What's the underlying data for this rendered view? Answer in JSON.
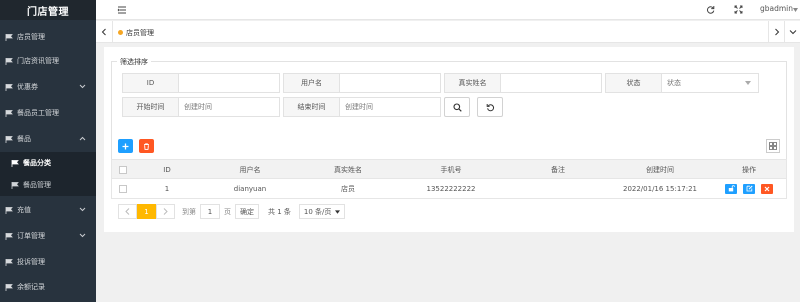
{
  "app": {
    "title": "门店管理"
  },
  "sidebar": {
    "items": [
      {
        "label": "店员管理"
      },
      {
        "label": "门店资讯管理"
      },
      {
        "label": "优惠券"
      },
      {
        "label": "餐品员工管理"
      },
      {
        "label": "餐品"
      },
      {
        "label": "充值"
      },
      {
        "label": "订单管理"
      },
      {
        "label": "投诉管理"
      },
      {
        "label": "余额记录"
      }
    ],
    "sub_items": [
      {
        "label": "餐品分类"
      },
      {
        "label": "餐品管理"
      }
    ]
  },
  "topbar": {
    "username": "gbadmin"
  },
  "tabs": [
    {
      "label": "店员管理"
    }
  ],
  "filter": {
    "legend": "筛选排序",
    "fields": {
      "id": {
        "label": "ID",
        "placeholder": ""
      },
      "username": {
        "label": "用户名",
        "placeholder": ""
      },
      "realname": {
        "label": "真实姓名",
        "placeholder": ""
      },
      "status": {
        "label": "状态",
        "value": "状态"
      },
      "start_time": {
        "label": "开始时间",
        "placeholder": "创建时间"
      },
      "end_time": {
        "label": "结束时间",
        "placeholder": "创建时间"
      }
    }
  },
  "table": {
    "headers": [
      "ID",
      "用户名",
      "真实姓名",
      "手机号",
      "备注",
      "创建时间",
      "操作"
    ],
    "rows": [
      {
        "id": "1",
        "username": "dianyuan",
        "realname": "店员",
        "phone": "13522222222",
        "remark": "",
        "created": "2022/01/16 15:17:21"
      }
    ]
  },
  "pagination": {
    "current": "1",
    "goto_label": "到第",
    "goto_value": "1",
    "page_unit": "页",
    "confirm": "确定",
    "total": "共 1 条",
    "page_size": "10 条/页"
  },
  "colors": {
    "sidebar_bg": "#28333e",
    "accent_blue": "#1e9fff",
    "accent_red": "#ff5722",
    "accent_yellow": "#ffb800"
  }
}
